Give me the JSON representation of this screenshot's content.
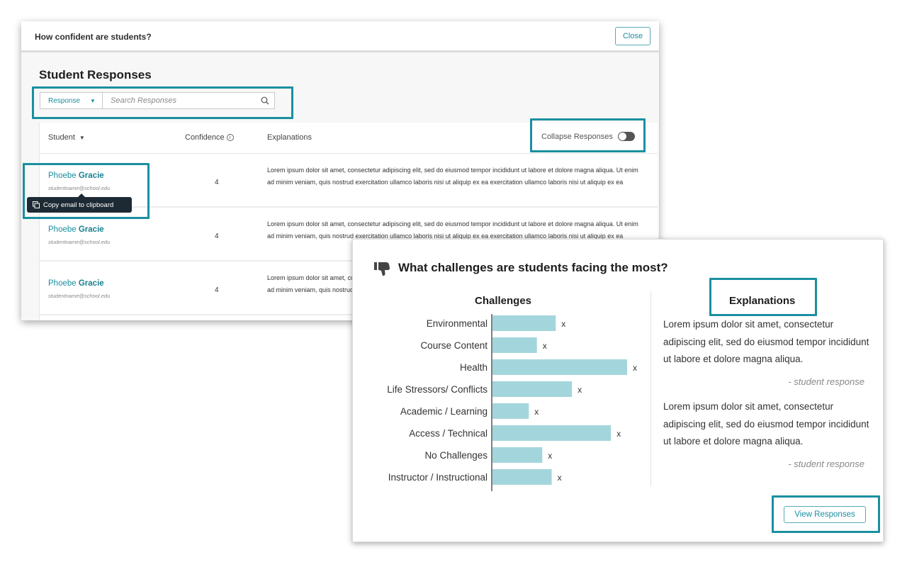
{
  "confidence_panel": {
    "title": "How confident are students?",
    "close_label": "Close",
    "section_title": "Student Responses",
    "filter": {
      "selected": "Response",
      "search_placeholder": "Search Responses",
      "search_value": ""
    },
    "columns": {
      "student": "Student",
      "confidence": "Confidence",
      "explanations": "Explanations"
    },
    "collapse_label": "Collapse Responses",
    "collapse_on": false,
    "tooltip": "Copy email to clipboard",
    "rows": [
      {
        "first": "Phoebe",
        "last": "Gracie",
        "email": "studentname@school.edu",
        "confidence": "4",
        "explanation": "Lorem ipsum dolor sit amet, consectetur adipiscing elit, sed do eiusmod tempor incididunt ut labore et dolore magna aliqua. Ut enim ad minim veniam, quis nostrud exercitation ullamco laboris nisi ut aliquip ex ea exercitation ullamco laboris nisi ut aliquip ex ea"
      },
      {
        "first": "Phoebe",
        "last": "Gracie",
        "email": "studentname@school.edu",
        "confidence": "4",
        "explanation": "Lorem ipsum dolor sit amet, consectetur adipiscing elit, sed do eiusmod tempor incididunt ut labore et dolore magna aliqua. Ut enim ad minim veniam, quis nostrud exercitation ullamco laboris nisi ut aliquip ex ea exercitation ullamco laboris nisi ut aliquip ex ea"
      },
      {
        "first": "Phoebe",
        "last": "Gracie",
        "email": "studentname@school.edu",
        "confidence": "4",
        "explanation": "Lorem ipsum dolor sit amet, consectetur adipiscing elit, sed do eiusmod tempor incididunt ut labore et dolore magna aliqua. Ut enim ad minim veniam, quis nostrud exercitation ullamco laboris nisi ut aliquip ex ea exercitation ullamco laboris nisi ut aliquip ex ea"
      }
    ]
  },
  "challenges_panel": {
    "title": "What challenges are students facing the most?",
    "icon": "thumbs-down-icon",
    "explanations_title": "Explanations",
    "explanations": [
      {
        "text": "Lorem ipsum dolor sit amet, consectetur adipiscing elit, sed do eiusmod tempor incididunt ut labore et dolore magna aliqua.",
        "attribution": "- student response"
      },
      {
        "text": "Lorem ipsum dolor sit amet, consectetur adipiscing elit, sed do eiusmod tempor incididunt ut labore et dolore magna aliqua.",
        "attribution": "- student response"
      }
    ],
    "view_button": "View Responses"
  },
  "colors": {
    "accent": "#1a8fa0",
    "bar": "#a3d6dc",
    "tooltip_bg": "#1e2a33"
  },
  "chart_data": {
    "type": "bar",
    "orientation": "horizontal",
    "title": "Challenges",
    "categories": [
      "Environmental",
      "Course Content",
      "Health",
      "Life Stressors/ Conflicts",
      "Academic / Learning",
      "Access  / Technical",
      "No Challenges",
      "Instructor  / Instructional"
    ],
    "values": [
      47,
      33,
      100,
      59,
      27,
      88,
      37,
      44
    ],
    "value_labels": [
      "x",
      "x",
      "x",
      "x",
      "x",
      "x",
      "x",
      "x"
    ],
    "value_unit": "relative (% of max, estimated)",
    "xlabel": "",
    "ylabel": "",
    "xlim": [
      0,
      100
    ],
    "grid": false,
    "legend": "none"
  }
}
